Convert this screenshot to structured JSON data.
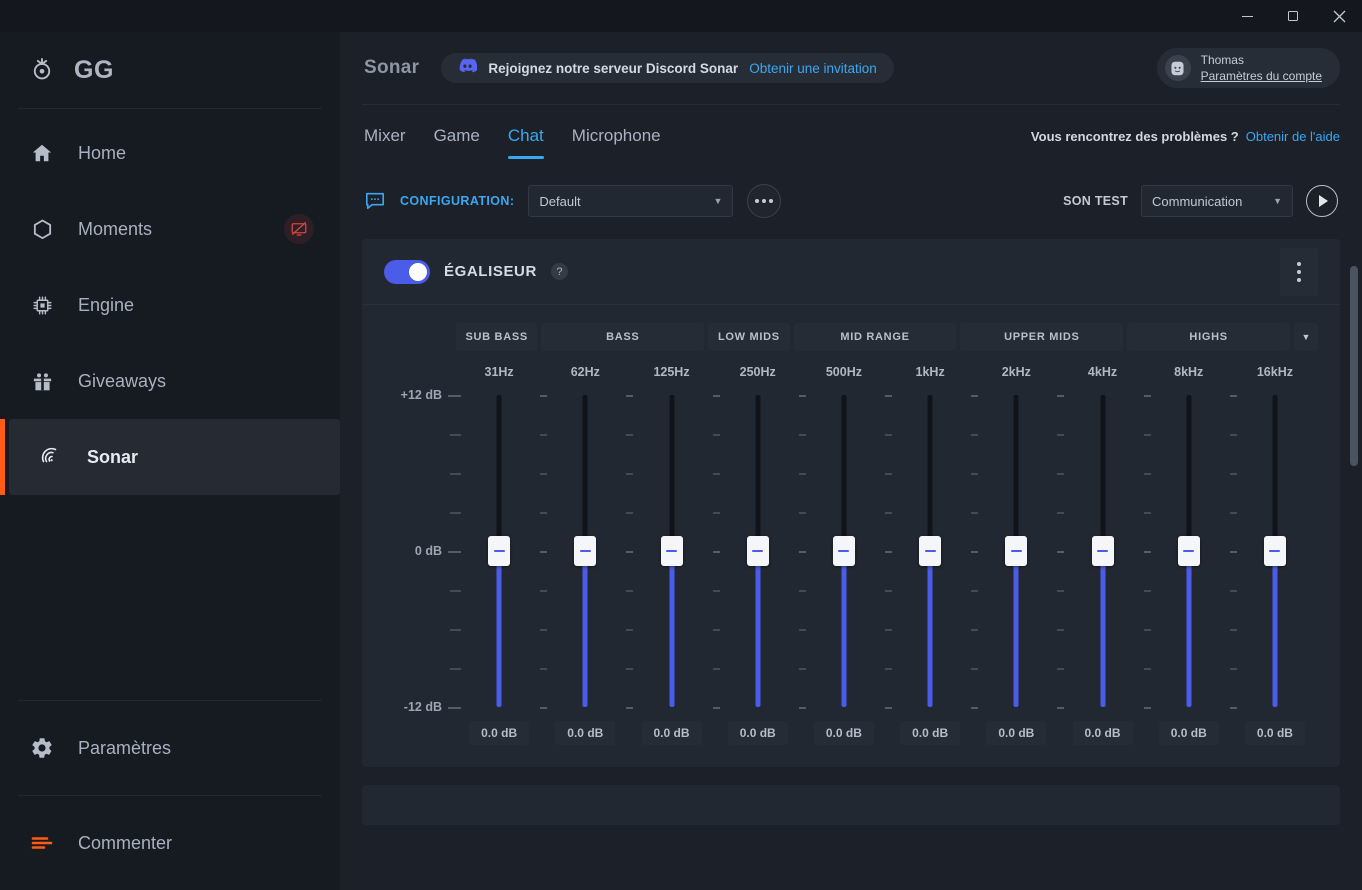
{
  "window": {
    "minimize_label": "Minimiser",
    "maximize_label": "Agrandir",
    "close_label": "×"
  },
  "sidebar": {
    "brand": "GG",
    "brand_icon": "steelseries-logo-icon",
    "items": [
      {
        "label": "Home",
        "icon": "home-icon",
        "active": false
      },
      {
        "label": "Moments",
        "icon": "hexagon-icon",
        "active": false,
        "badge_icon": "screen-off-icon"
      },
      {
        "label": "Engine",
        "icon": "chip-icon",
        "active": false
      },
      {
        "label": "Giveaways",
        "icon": "gift-icon",
        "active": false
      },
      {
        "label": "Sonar",
        "icon": "sonar-icon",
        "active": true
      }
    ],
    "bottom_items": [
      {
        "label": "Paramètres",
        "icon": "gear-icon"
      },
      {
        "label": "Commenter",
        "icon": "feedback-icon"
      }
    ],
    "accent_color": "#ff5c16"
  },
  "header": {
    "title": "Sonar",
    "discord_icon": "discord-icon",
    "discord_text": "Rejoignez notre serveur Discord Sonar",
    "discord_link": "Obtenir une invitation",
    "account": {
      "name": "Thomas",
      "settings_link": "Paramètres du compte",
      "avatar_icon": "avatar-icon"
    }
  },
  "tabs": {
    "items": [
      {
        "label": "Mixer",
        "active": false
      },
      {
        "label": "Game",
        "active": false
      },
      {
        "label": "Chat",
        "active": true
      },
      {
        "label": "Microphone",
        "active": false
      }
    ],
    "help_question": "Vous rencontrez des problèmes ?",
    "help_link": "Obtenir de l'aide",
    "accent_color": "#3ba7f0"
  },
  "config_bar": {
    "icon": "chat-bubble-icon",
    "label": "CONFIGURATION:",
    "preset_value": "Default",
    "more_button_icon": "ellipsis-icon",
    "sound_test_label": "SON TEST",
    "sound_test_value": "Communication",
    "play_button_icon": "play-icon"
  },
  "equalizer": {
    "enabled": true,
    "title": "ÉGALISEUR",
    "help_glyph": "?",
    "menu_icon": "kebab-menu-icon",
    "band_groups": [
      {
        "label": "SUB BASS",
        "span": 1
      },
      {
        "label": "BASS",
        "span": 2
      },
      {
        "label": "LOW MIDS",
        "span": 1
      },
      {
        "label": "MID RANGE",
        "span": 2
      },
      {
        "label": "UPPER MIDS",
        "span": 2
      },
      {
        "label": "HIGHS",
        "span": 2
      }
    ],
    "group_caret_icon": "chevron-down-icon",
    "axis_labels": [
      "+12 dB",
      "0 dB",
      "-12 dB"
    ],
    "bands": [
      {
        "freq": "31Hz",
        "value": "0.0 dB",
        "db": 0.0
      },
      {
        "freq": "62Hz",
        "value": "0.0 dB",
        "db": 0.0
      },
      {
        "freq": "125Hz",
        "value": "0.0 dB",
        "db": 0.0
      },
      {
        "freq": "250Hz",
        "value": "0.0 dB",
        "db": 0.0
      },
      {
        "freq": "500Hz",
        "value": "0.0 dB",
        "db": 0.0
      },
      {
        "freq": "1kHz",
        "value": "0.0 dB",
        "db": 0.0
      },
      {
        "freq": "2kHz",
        "value": "0.0 dB",
        "db": 0.0
      },
      {
        "freq": "4kHz",
        "value": "0.0 dB",
        "db": 0.0
      },
      {
        "freq": "8kHz",
        "value": "0.0 dB",
        "db": 0.0
      },
      {
        "freq": "16kHz",
        "value": "0.0 dB",
        "db": 0.0
      }
    ],
    "slider_color": "#4a5ce8",
    "range_min": -12,
    "range_max": 12
  }
}
